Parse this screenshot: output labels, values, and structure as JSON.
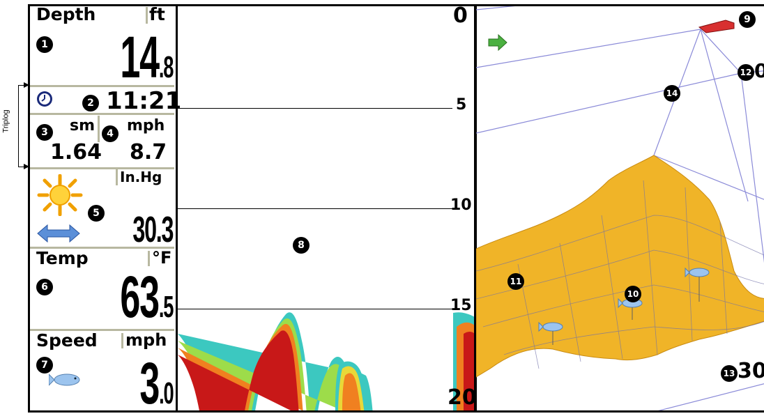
{
  "triplog_label": "Triplog",
  "depth": {
    "label": "Depth",
    "unit": "ft",
    "value_int": "14",
    "value_dec": ".8"
  },
  "clock": {
    "icon": "clock-icon",
    "time": "11:21"
  },
  "trip": {
    "dist_unit": "sm",
    "speed_unit": "mph",
    "distance": "1.64",
    "avg_speed": "8.7"
  },
  "baro": {
    "unit": "In.Hg",
    "weather_icon": "sun-icon",
    "trend_icon": "double-arrow-icon",
    "value": "30.3"
  },
  "temp": {
    "label": "Temp",
    "unit": "°F",
    "value_int": "63",
    "value_dec": ".5"
  },
  "speed": {
    "label": "Speed",
    "unit": "mph",
    "icon": "fish-icon",
    "value_int": "3",
    "value_dec": ".0"
  },
  "sonar": {
    "scale": [
      "0",
      "5",
      "10",
      "15",
      "20"
    ]
  },
  "view3d": {
    "labels": [
      "0",
      "30"
    ],
    "boat_icon": "boat-icon",
    "cursor_icon": "arrow-icon"
  },
  "callouts": [
    "1",
    "2",
    "3",
    "4",
    "5",
    "6",
    "7",
    "8",
    "9",
    "10",
    "11",
    "12",
    "13",
    "14"
  ]
}
